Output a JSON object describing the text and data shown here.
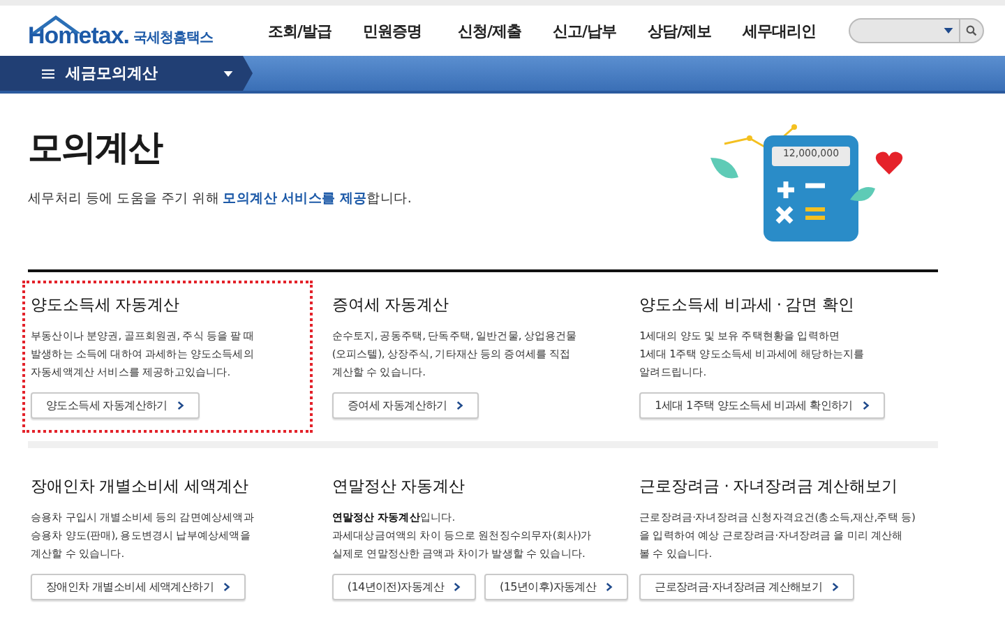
{
  "header": {
    "logo": {
      "brand": "Hometax.",
      "name": "국세청홈택스"
    },
    "nav": [
      {
        "label": "조회/발급"
      },
      {
        "label": "민원증명"
      },
      {
        "label": "신청/제출"
      },
      {
        "label": "신고/납부"
      },
      {
        "label": "상담/제보"
      },
      {
        "label": "세무대리인"
      }
    ]
  },
  "breadcrumb": {
    "label": "세금모의계산"
  },
  "page": {
    "title": "모의계산",
    "subtitle": "세무처리 등에 도움을 주기 위해 **모의계산 서비스를 제공**합니다.",
    "illustration": {
      "display": "12,000,000"
    }
  },
  "cards": [
    {
      "title": "양도소득세 자동계산",
      "highlighted": true,
      "description": "부동산이나 분양권, 골프회원권, 주식 등을 팔 때\n발생하는 소득에 대하여 과세하는 양도소득세의\n자동세액계산 서비스를 제공하고있습니다.",
      "buttons": [
        "양도소득세 자동계산하기"
      ]
    },
    {
      "title": "증여세 자동계산",
      "highlighted": false,
      "description": "순수토지, 공동주택, 단독주택, 일반건물, 상업용건물\n(오피스텔), 상장주식, 기타재산 등의 증여세를 직접\n계산할 수 있습니다.",
      "buttons": [
        "증여세 자동계산하기"
      ]
    },
    {
      "title": "양도소득세 비과세 · 감면 확인",
      "highlighted": false,
      "description": "1세대의 양도 및 보유 주택현황을 입력하면\n1세대 1주택 양도소득세 비과세에 해당하는지를\n알려드립니다.",
      "buttons": [
        "1세대 1주택 양도소득세 비과세 확인하기"
      ]
    },
    {
      "title": "장애인차 개별소비세 세액계산",
      "highlighted": false,
      "description": "승용차 구입시 개별소비세 등의 감면예상세액과\n승용차 양도(판매), 용도변경시 납부예상세액을\n계산할 수 있습니다.",
      "buttons": [
        "장애인차 개별소비세 세액계산하기"
      ]
    },
    {
      "title": "연말정산 자동계산",
      "highlighted": false,
      "description": "**연말정산 자동계산**입니다.\n과세대상금여액의 차이 등으로 원천징수의무자(회사)가\n실제로 연말정산한 금액과 차이가 발생할 수 있습니다.",
      "buttons": [
        "(14년이전)자동계산",
        "(15년이후)자동계산"
      ]
    },
    {
      "title": "근로장려금 · 자녀장려금 계산해보기",
      "highlighted": false,
      "description": "근로장려금·자녀장려금 신청자격요건(총소득,재산,주택 등)\n을 입력하여 예상 근로장려금·자녀장려금 을 미리 계산해\n볼 수 있습니다.",
      "buttons": [
        "근로장려금·자녀장려금 계산해보기"
      ]
    }
  ]
}
